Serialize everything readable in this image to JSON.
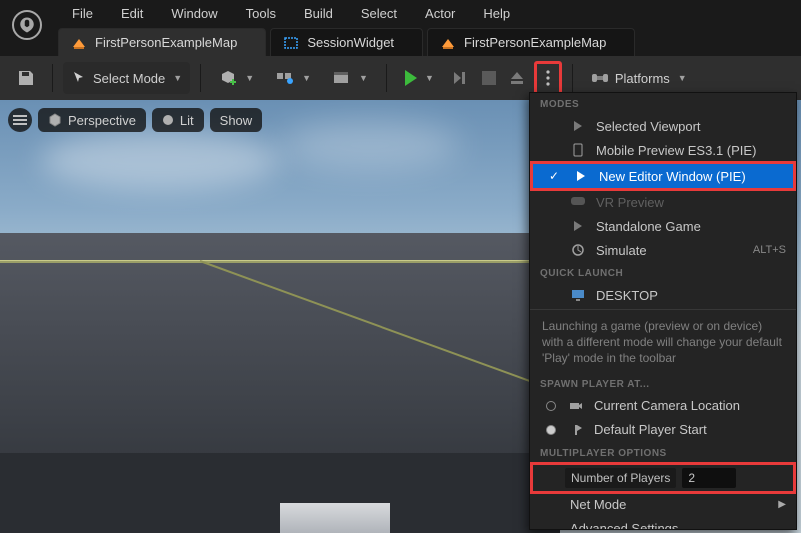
{
  "menu": {
    "file": "File",
    "edit": "Edit",
    "window": "Window",
    "tools": "Tools",
    "build": "Build",
    "select": "Select",
    "actor": "Actor",
    "help": "Help"
  },
  "tabs": [
    {
      "label": "FirstPersonExampleMap",
      "active": true,
      "icon": "level-icon"
    },
    {
      "label": "SessionWidget",
      "active": false,
      "icon": "widget-icon"
    },
    {
      "label": "FirstPersonExampleMap",
      "active": false,
      "icon": "level-icon"
    }
  ],
  "toolbar": {
    "save_tip": "Save",
    "select_mode": "Select Mode",
    "platforms": "Platforms"
  },
  "viewport": {
    "perspective": "Perspective",
    "lit": "Lit",
    "show": "Show"
  },
  "panel": {
    "modes_hdr": "MODES",
    "modes": [
      {
        "label": "Selected Viewport",
        "state": "normal"
      },
      {
        "label": "Mobile Preview ES3.1 (PIE)",
        "state": "normal"
      },
      {
        "label": "New Editor Window (PIE)",
        "state": "selected"
      },
      {
        "label": "VR Preview",
        "state": "disabled"
      },
      {
        "label": "Standalone Game",
        "state": "normal"
      },
      {
        "label": "Simulate",
        "state": "normal",
        "shortcut": "ALT+S"
      }
    ],
    "quick_launch_hdr": "QUICK LAUNCH",
    "quick_launch": "DESKTOP",
    "note": "Launching a game (preview or on device) with a different mode will change your default 'Play' mode in the toolbar",
    "spawn_hdr": "SPAWN PLAYER AT...",
    "spawn": [
      {
        "label": "Current Camera Location",
        "checked": false
      },
      {
        "label": "Default Player Start",
        "checked": true
      }
    ],
    "mp_hdr": "MULTIPLAYER OPTIONS",
    "num_players_label": "Number of Players",
    "num_players_value": "2",
    "net_mode": "Net Mode",
    "advanced": "Advanced Settings..."
  }
}
